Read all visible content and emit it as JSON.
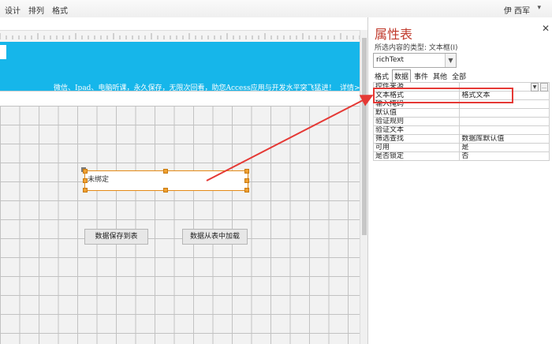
{
  "ribbon": {
    "tabs": [
      "设计",
      "排列",
      "格式"
    ],
    "user": "伊 西军"
  },
  "form": {
    "header_text": "微信、Ipad、电脑听课，永久保存，无限次回看，助您Access应用与开发水平突飞猛进！",
    "header_more": "详情>",
    "textbox_label": "未绑定",
    "save_button": "数据保存到表",
    "load_button": "数据从表中加载"
  },
  "property_sheet": {
    "title": "属性表",
    "subtitle": "所选内容的类型: 文本框(I)",
    "selected_control": "richText",
    "tabs": [
      "格式",
      "数据",
      "事件",
      "其他",
      "全部"
    ],
    "active_tab": "数据",
    "rows": [
      {
        "name": "控件来源",
        "value": ""
      },
      {
        "name": "文本格式",
        "value": "格式文本"
      },
      {
        "name": "输入掩码",
        "value": ""
      },
      {
        "name": "默认值",
        "value": ""
      },
      {
        "name": "验证规则",
        "value": ""
      },
      {
        "name": "验证文本",
        "value": ""
      },
      {
        "name": "筛选查找",
        "value": "数据库默认值"
      },
      {
        "name": "可用",
        "value": "是"
      },
      {
        "name": "是否锁定",
        "value": "否"
      }
    ]
  },
  "colors": {
    "header_band": "#16b6ea",
    "title_red": "#c0392b",
    "annotation_red": "#e53935",
    "selection_orange": "#f0a030"
  },
  "icons": {
    "close": "close-icon",
    "dropdown": "chevron-down-icon"
  }
}
